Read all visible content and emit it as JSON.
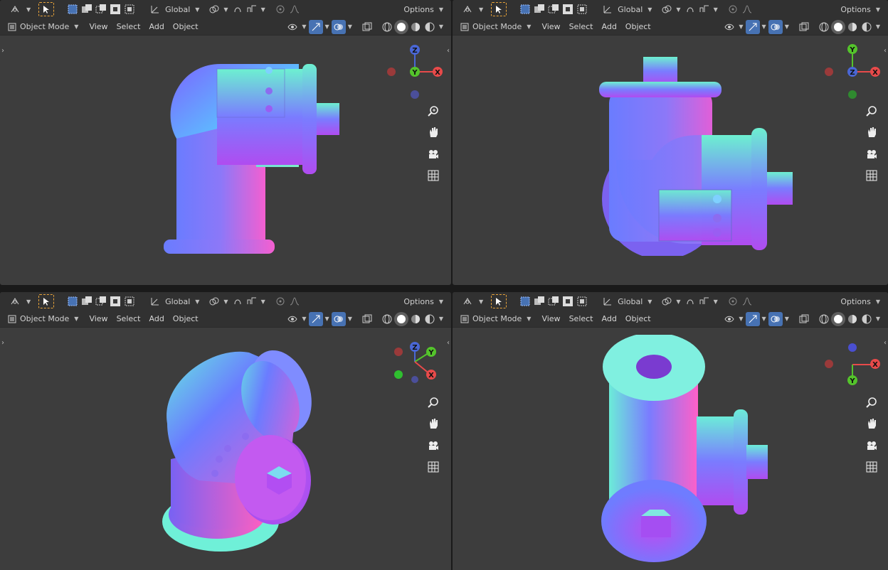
{
  "header": {
    "transform_orientation": "Global",
    "options_label": "Options"
  },
  "menu": {
    "mode": "Object Mode",
    "view": "View",
    "select": "Select",
    "add": "Add",
    "object": "Object"
  },
  "axes": {
    "x": "X",
    "y": "Y",
    "z": "Z"
  },
  "colors": {
    "x_axis": "#e84a4a",
    "y_axis": "#54c42b",
    "z_axis": "#4a67d6",
    "select_box": "#e8a33a",
    "accent": "#4772b3"
  },
  "icons": [
    "cursor-icon",
    "select-box-icon",
    "transform-icon",
    "snap-icon",
    "proportional-edit-icon",
    "visibility-icon",
    "gizmo-icon",
    "overlay-icon",
    "xray-icon",
    "wireframe-icon",
    "solid-icon",
    "material-icon",
    "rendered-icon",
    "zoom-icon",
    "hand-icon",
    "camera-icon",
    "grid-icon"
  ],
  "viewports": [
    {
      "id": "top-left",
      "view": "front"
    },
    {
      "id": "top-right",
      "view": "side"
    },
    {
      "id": "bottom-left",
      "view": "perspective"
    },
    {
      "id": "bottom-right",
      "view": "top"
    }
  ]
}
